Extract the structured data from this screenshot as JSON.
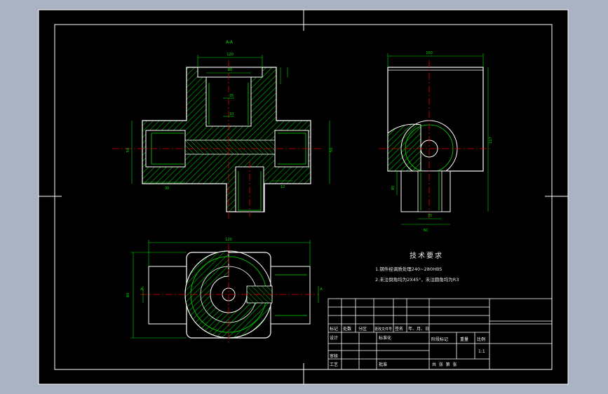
{
  "colors": {
    "background": "#a9b3c3",
    "sheet": "#000000",
    "border": "#ffffff",
    "outline": "#ffffff",
    "hatch": "#00c000",
    "dimension": "#00e000",
    "centerline": "#e00000",
    "text": "#ffffff",
    "tech_text": "#e8e8e8"
  },
  "front_view": {
    "section_label": "A-A",
    "dims": {
      "top_width": "120",
      "inner_width": "80",
      "depth_1": "35",
      "depth_2": "10",
      "left_height": "50",
      "right_height": "50",
      "left_bottom": "30",
      "right_bottom": "12"
    }
  },
  "side_view": {
    "dims": {
      "top_width": "100",
      "overall_height": "117",
      "bottom_width": "60",
      "bottom_inner": "35",
      "side": "40"
    }
  },
  "top_view": {
    "dims": {
      "overall_width": "120",
      "overall_height": "80"
    },
    "section_mark_left": "A",
    "section_mark_right": "A"
  },
  "tech_requirements": {
    "title": "技术要求",
    "line1": "1.钢件经调质处理240~280HBS",
    "line2": "2.未注倒角均为2X45°，未注圆角均为R3"
  },
  "title_block": {
    "header_cells": [
      "标记",
      "处数",
      "分区",
      "更改文件号",
      "签名",
      "年、月、日"
    ],
    "design": "设计",
    "standardize": "标准化",
    "stage_mark": "阶段标记",
    "weight": "重量",
    "scale": "比例",
    "scale_value": "1:1",
    "review": "审核",
    "process": "工艺",
    "approve": "批准",
    "sheets": "共  张  第  张"
  }
}
